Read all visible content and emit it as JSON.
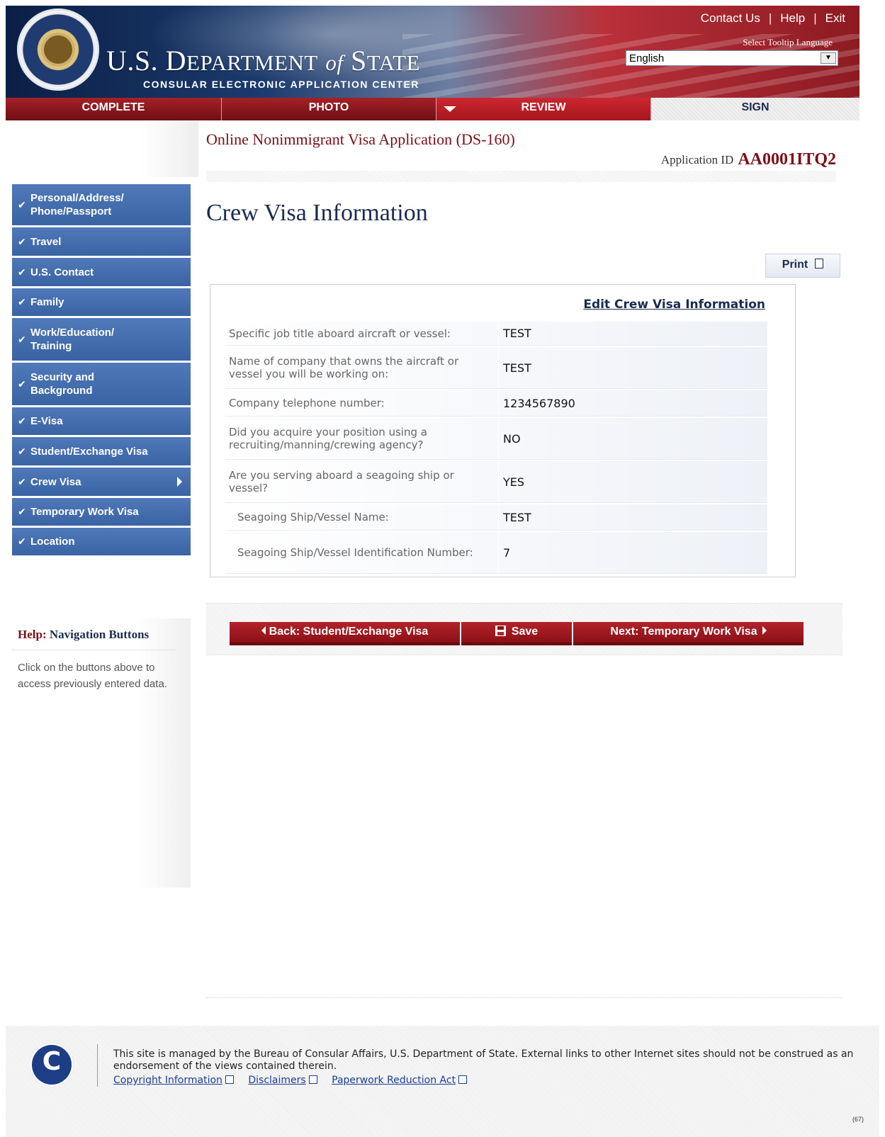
{
  "header": {
    "title": "U.S. Department of State",
    "subtitle": "CONSULAR ELECTRONIC APPLICATION CENTER",
    "links": [
      "Contact Us",
      "Help",
      "Exit"
    ],
    "tooltip_label": "Select Tooltip Language",
    "language_value": "English"
  },
  "tabs": [
    {
      "label": "COMPLETE"
    },
    {
      "label": "PHOTO"
    },
    {
      "label": "REVIEW",
      "active": true
    },
    {
      "label": "SIGN"
    }
  ],
  "sidebar": {
    "items": [
      {
        "label": "Personal/Address/ Phone/Passport"
      },
      {
        "label": "Travel"
      },
      {
        "label": "U.S. Contact"
      },
      {
        "label": "Family"
      },
      {
        "label": "Work/Education/ Training"
      },
      {
        "label": "Security and Background"
      },
      {
        "label": "E-Visa"
      },
      {
        "label": "Student/Exchange Visa"
      },
      {
        "label": "Crew Visa",
        "current": true
      },
      {
        "label": "Temporary Work Visa"
      },
      {
        "label": "Location"
      }
    ]
  },
  "help": {
    "title_prefix": "Help:",
    "title_rest": "Navigation Buttons",
    "text": "Click on the buttons above to access previously entered data."
  },
  "main": {
    "app_title": "Online Nonimmigrant Visa Application (DS-160)",
    "app_id_label": "Application ID",
    "app_id": "AA0001ITQ2",
    "heading": "Crew Visa Information",
    "print_label": "Print",
    "edit_link": "Edit Crew Visa Information",
    "rows": [
      {
        "q": "Specific job title aboard aircraft or vessel:",
        "a": "TEST"
      },
      {
        "q": "Name of company that owns the aircraft or vessel you will be working on:",
        "a": "TEST"
      },
      {
        "q": "Company telephone number:",
        "a": "1234567890"
      },
      {
        "q": "Did you acquire your position using a recruiting/manning/crewing agency?",
        "a": "NO"
      },
      {
        "q": "Are you serving aboard a seagoing ship or vessel?",
        "a": "YES"
      },
      {
        "q": "Seagoing Ship/Vessel Name:",
        "a": "TEST"
      },
      {
        "q": "Seagoing Ship/Vessel Identification Number:",
        "a": "7"
      }
    ]
  },
  "buttons": {
    "back": "Back: Student/Exchange Visa",
    "save": "Save",
    "next": "Next: Temporary Work Visa"
  },
  "footer": {
    "text": "This site is managed by the Bureau of Consular Affairs, U.S. Department of State. External links to other Internet sites should not be construed as an endorsement of the views contained therein.",
    "links": [
      "Copyright Information",
      "Disclaimers",
      "Paperwork Reduction Act"
    ],
    "version": "(67)"
  }
}
